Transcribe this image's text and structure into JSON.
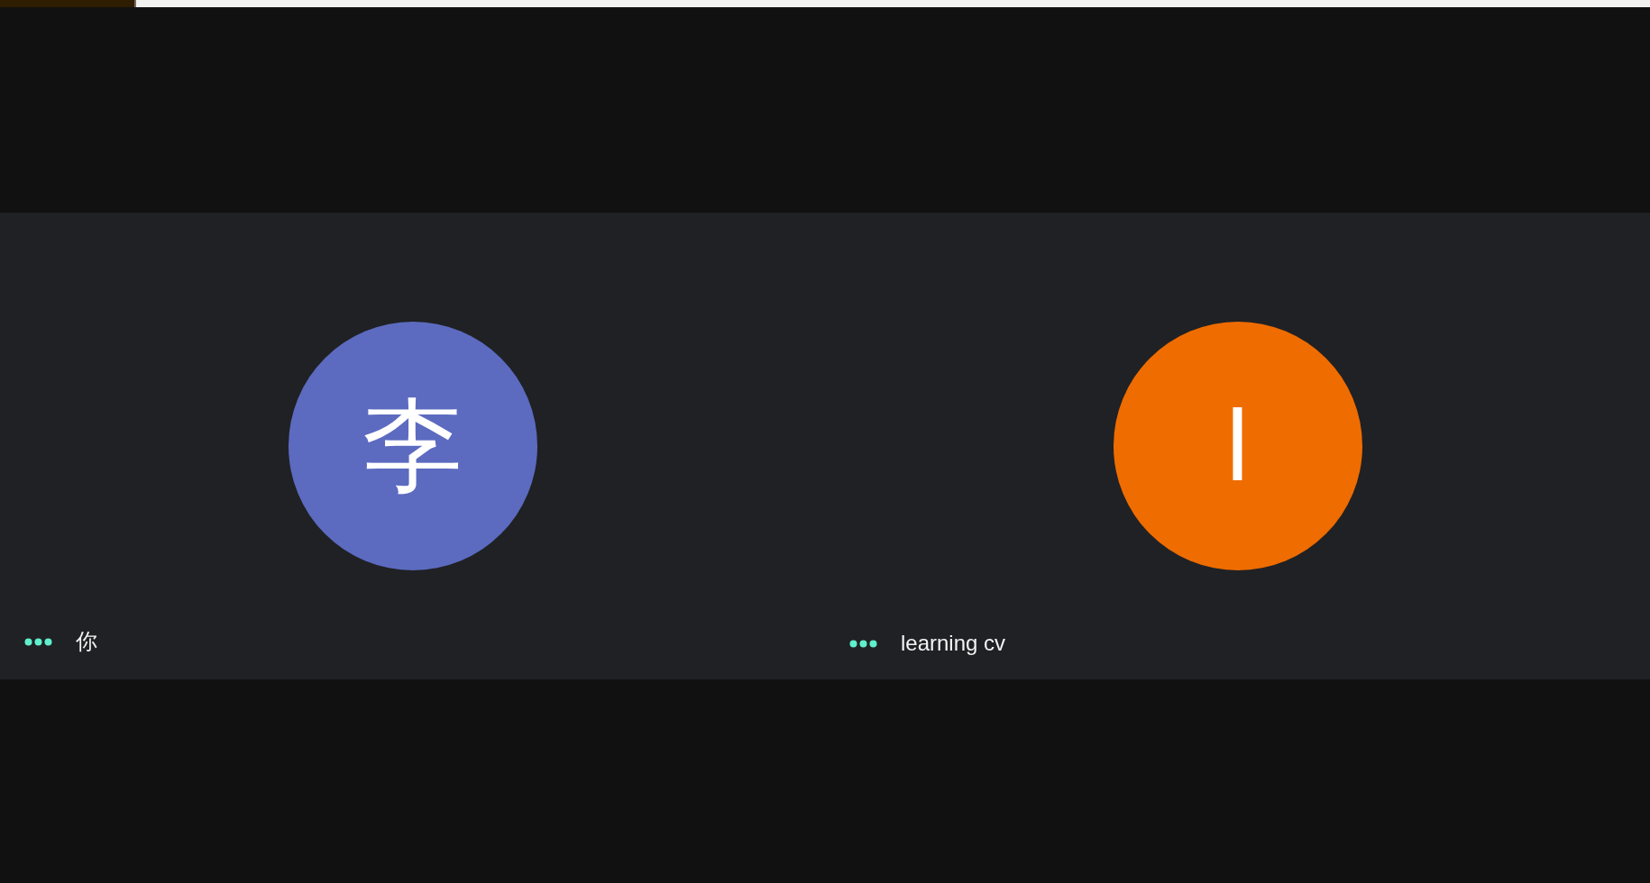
{
  "participants": [
    {
      "initial": "李",
      "name": "你",
      "color": "#5c6bc0"
    },
    {
      "initial": "l",
      "name": "learning cv",
      "color": "#ef6c00"
    }
  ]
}
